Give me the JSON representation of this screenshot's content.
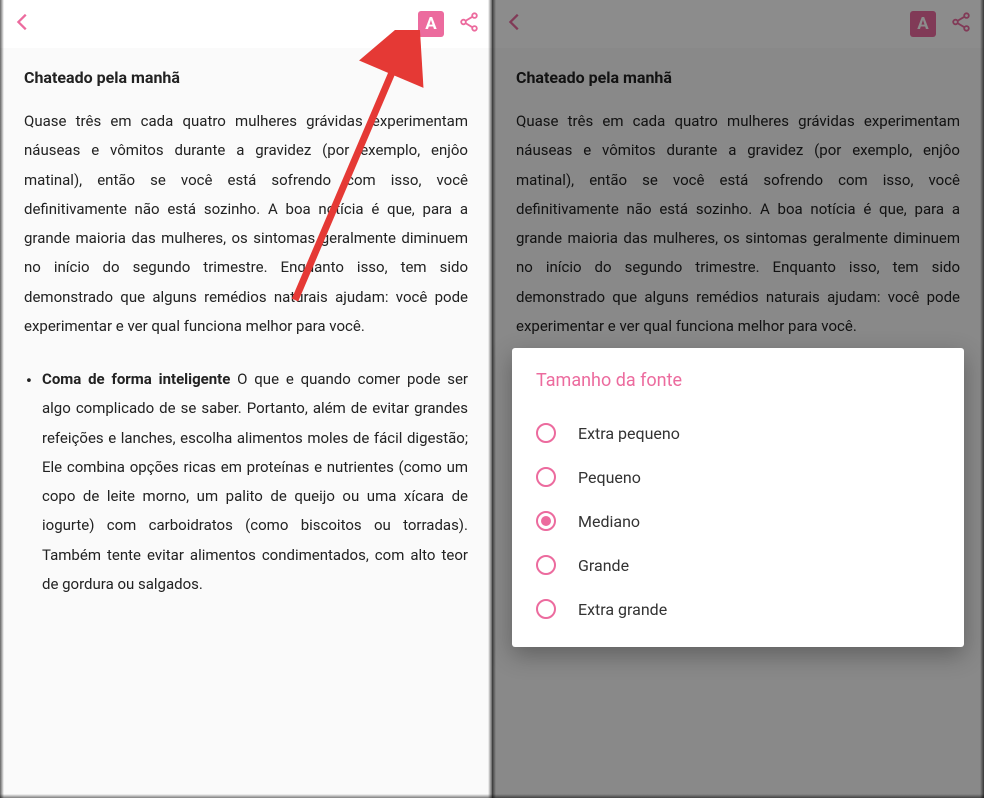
{
  "article": {
    "title": "Chateado pela manhã",
    "body": "Quase três em cada quatro mulheres grávidas experimentam náuseas e vômitos durante a gravidez (por exemplo, enjôo matinal), então se você está sofrendo com isso, você definitivamente não está sozinho. A boa notícia é que, para a grande maioria das mulheres, os sintomas geralmente diminuem no início do segundo trimestre. Enquanto isso, tem sido demonstrado que alguns remédios naturais ajudam: você pode experimentar e ver qual funciona melhor para você.",
    "bullet_title": "Coma de forma inteligente",
    "bullet_body": " O que e quando comer pode ser algo complicado de se saber. Portanto, além de evitar grandes refeições e lanches, escolha alimentos moles de fácil digestão; Ele combina opções ricas em proteínas e nutrientes (como um copo de leite morno, um palito de queijo ou uma xícara de iogurte) com carboidratos (como biscoitos ou torradas). Também tente evitar alimentos condimentados, com alto teor de gordura ou salgados."
  },
  "dialog": {
    "title": "Tamanho da fonte",
    "options": [
      {
        "label": "Extra pequeno",
        "selected": false
      },
      {
        "label": "Pequeno",
        "selected": false
      },
      {
        "label": "Mediano",
        "selected": true
      },
      {
        "label": "Grande",
        "selected": false
      },
      {
        "label": "Extra grande",
        "selected": false
      }
    ]
  },
  "icons": {
    "font_letter": "A"
  }
}
